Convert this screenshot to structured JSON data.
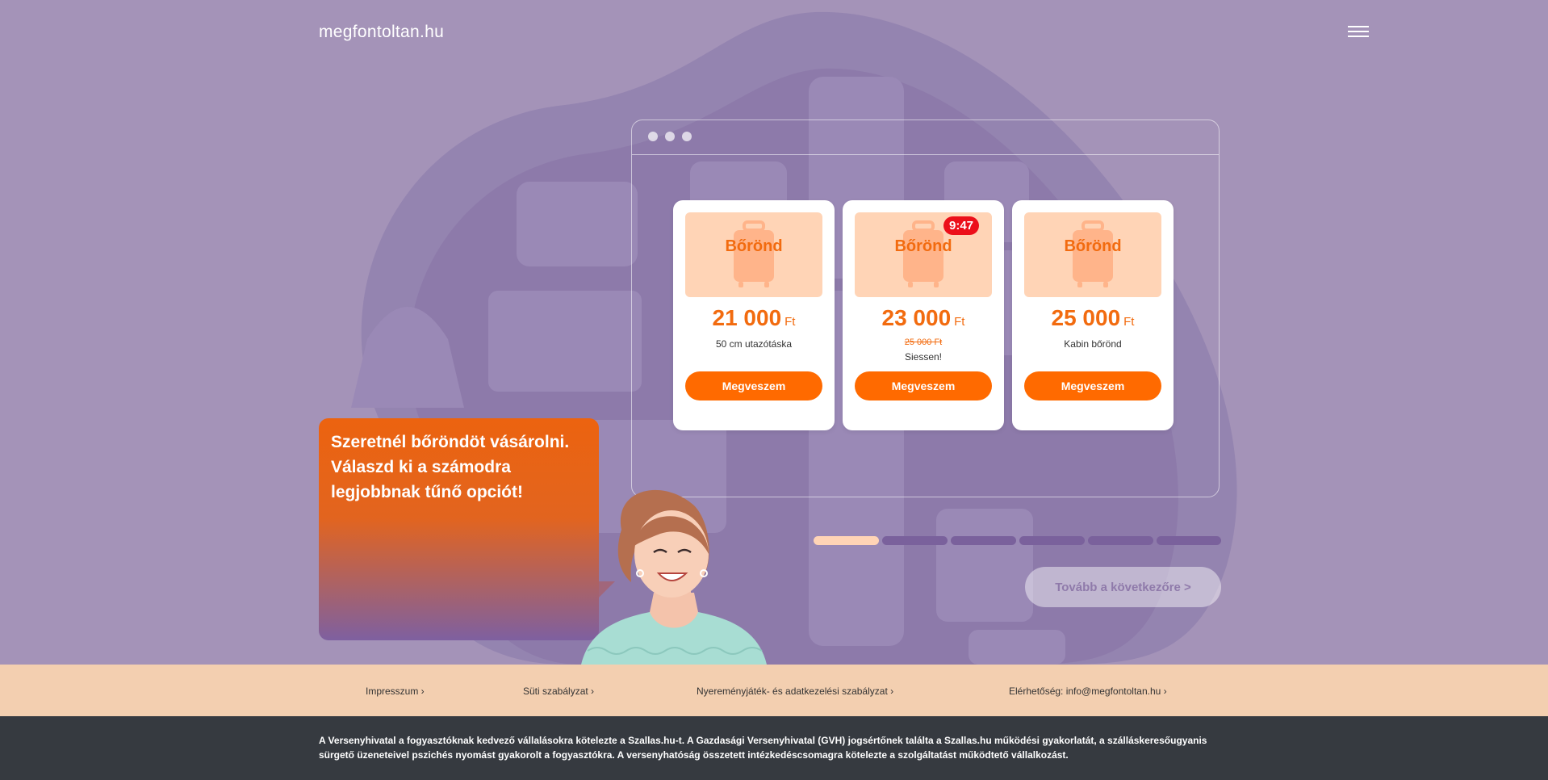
{
  "header": {
    "logo": "megfontoltan.hu",
    "menu_icon": "hamburger-menu-icon"
  },
  "browser_window": {
    "dots_icon": "window-dots-icon"
  },
  "products": [
    {
      "image_label": "Bőrönd",
      "icon": "suitcase-icon",
      "price": "21 000",
      "currency": "Ft",
      "description": "50 cm utazótáska",
      "button": "Megveszem"
    },
    {
      "image_label": "Bőrönd",
      "icon": "suitcase-icon",
      "timer": "9:47",
      "price": "23 000",
      "currency": "Ft",
      "old_price": "25 000 Ft",
      "description": "Siessen!",
      "button": "Megveszem"
    },
    {
      "image_label": "Bőrönd",
      "icon": "suitcase-icon",
      "price": "25 000",
      "currency": "Ft",
      "description": "Kabin bőrönd",
      "button": "Megveszem"
    }
  ],
  "bubble": {
    "text": "Szeretnél bőröndöt vásárolni. Válaszd ki a számodra legjobbnak tűnő opciót!"
  },
  "progress": {
    "total_steps": 6,
    "current_step": 1,
    "active_color": "#ffd4b6",
    "inactive_color": "#7a619c"
  },
  "next_button": "Tovább a következőre >",
  "footer": {
    "links": [
      "Impresszum ›",
      "Süti szabályzat ›",
      "Nyereményjáték- és adatkezelési szabályzat ›",
      "Elérhetőség: info@megfontoltan.hu ›"
    ]
  },
  "notice": {
    "text": "A Versenyhivatal a fogyasztóknak kedvező vállalásokra kötelezte a Szallas.hu-t. A Gazdasági Versenyhivatal (GVH) jogsértőnek találta a Szallas.hu működési gyakorlatát, a szálláskeresőugyanis sürgető üzeneteivel pszichés nyomást gyakorolt a fogyasztókra. A versenyhatóság összetett intézkedéscsomagra kötelezte a szolgáltatást működtető vállalkozást."
  },
  "colors": {
    "background": "#a493b8",
    "accent": "#ff6a00",
    "timer": "#ec0f1a",
    "footer_light": "#f3cfb0",
    "footer_dark": "#363a40"
  }
}
